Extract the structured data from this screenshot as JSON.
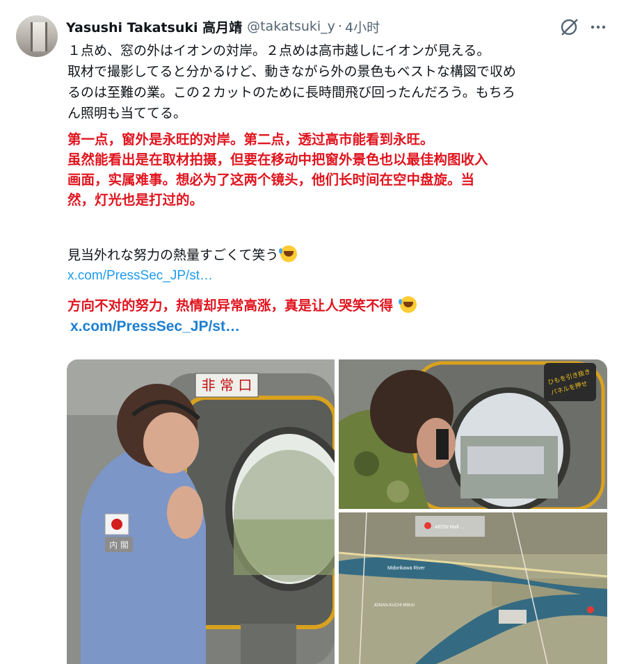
{
  "author": {
    "name": "Yasushi Takatsuki 高月靖",
    "handle": "@takatsuki_y",
    "separator": "·",
    "time": "4小时"
  },
  "icons": {
    "grok": "grok-icon",
    "more": "more-icon",
    "emoji": "rolling-laughing-emoji"
  },
  "colors": {
    "link": "#1d9bf0",
    "red_text": "#e0141e",
    "secondary": "#536471"
  },
  "tweet": {
    "jp_lines": [
      "１点め、窓の外はイオンの対岸。２点めは高市越しにイオンが見える。",
      "取材で撮影してると分かるけど、動きながら外の景色もベストな構図で収め",
      "るのは至難の業。この２カットのために長時間飛び回ったんだろう。もちろ",
      "ん照明も当ててる。"
    ],
    "cn_lines": [
      "第一点，窗外是永旺的对岸。第二点，透过高市能看到永旺。",
      "虽然能看出是在取材拍摄，但要在移动中把窗外景色也以最佳构图收入",
      "画面，实属难事。想必为了这两个镜头，他们长时间在空中盘旋。当",
      "然，灯光也是打过的。"
    ],
    "jp_line2": "見当外れな努力の熱量すごくて笑う",
    "link1": "x.com/PressSec_JP/st…",
    "cn_line2": "方向不对的努力，热情却异常高涨，真是让人哭笑不得",
    "link2": "x.com/PressSec_JP/st…"
  },
  "media": {
    "main": {
      "sign": "非 常 口",
      "patch": "内 閣"
    },
    "top_right": {
      "sign_line1": "ひもを引き抜き",
      "sign_line2": "パネルを押せ"
    },
    "map": {
      "label_store": "AEON Mall ...",
      "label_river": "Midorikawa River",
      "label_area": "JONAN-KUCHI MIKAI"
    }
  }
}
